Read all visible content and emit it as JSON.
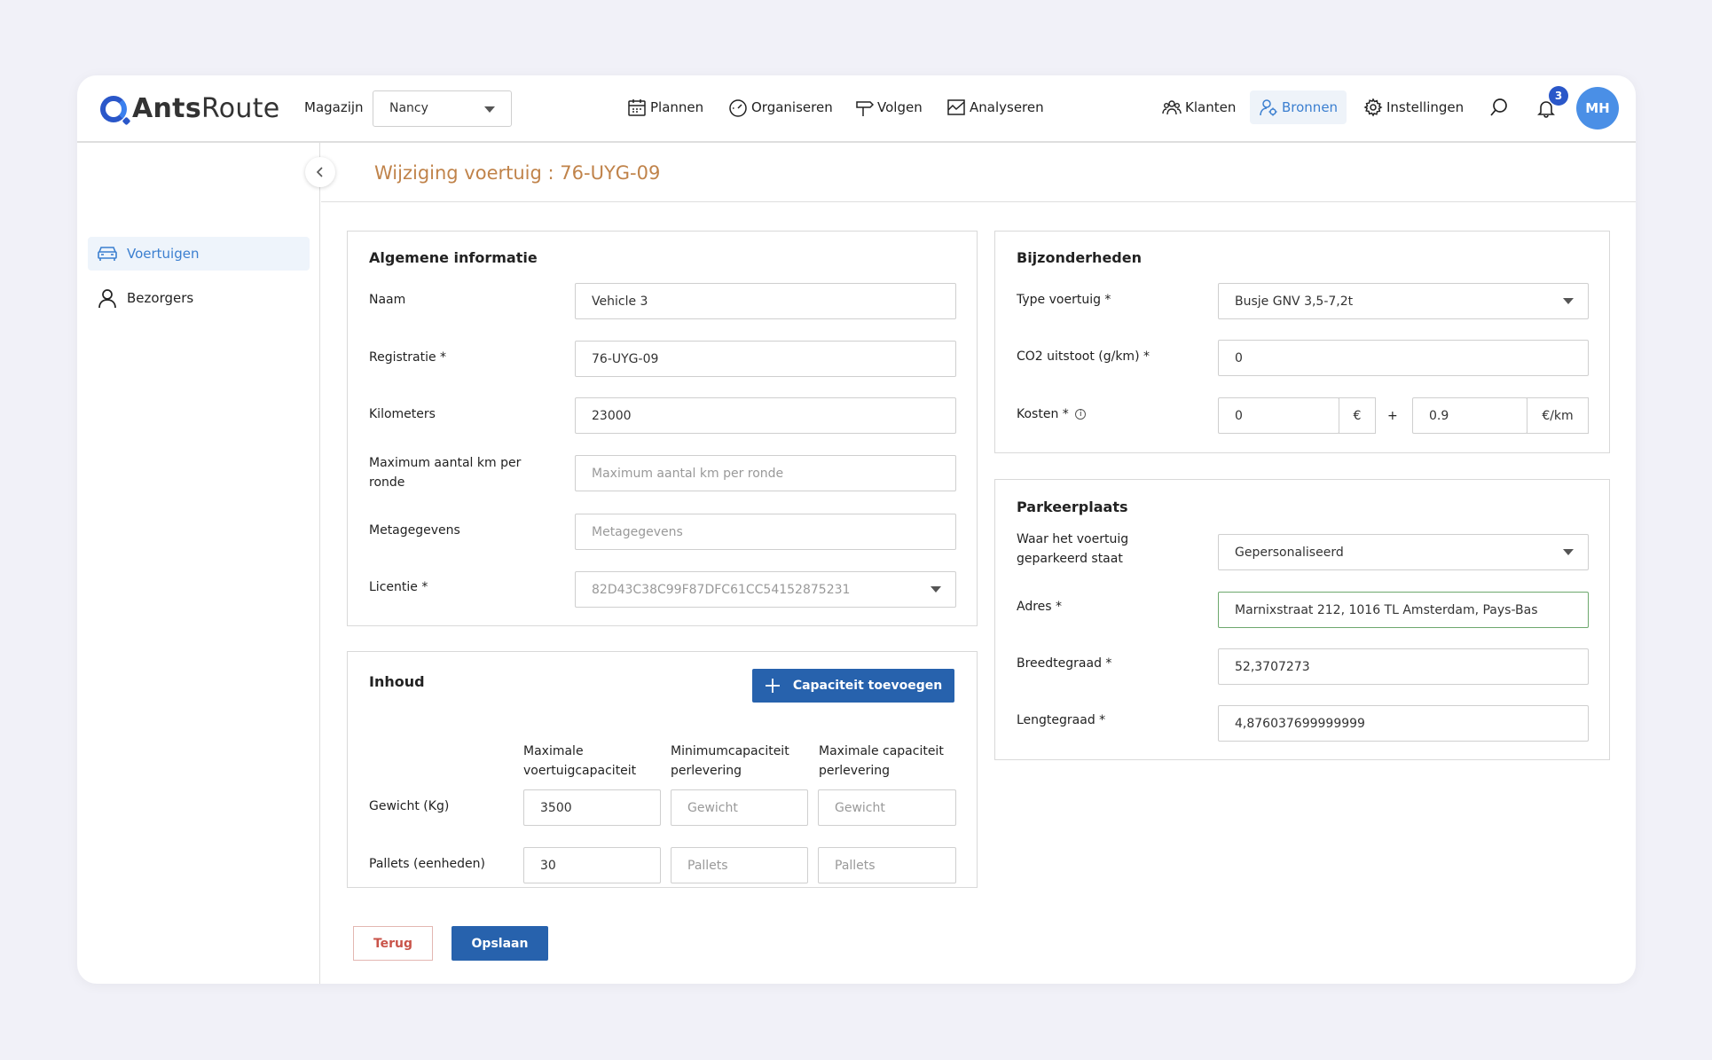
{
  "app": {
    "logo_bold": "Ants",
    "logo_light": "Route"
  },
  "topbar": {
    "warehouse_label": "Magazijn",
    "warehouse_value": "Nancy",
    "nav": {
      "plannen": "Plannen",
      "organiseren": "Organiseren",
      "volgen": "Volgen",
      "analyseren": "Analyseren",
      "klanten": "Klanten",
      "bronnen": "Bronnen",
      "instellingen": "Instellingen"
    },
    "notification_count": "3",
    "avatar_initials": "MH",
    "accent_color": "#2a57c9"
  },
  "sidebar": {
    "items": [
      {
        "label": "Voertuigen",
        "icon": "car-icon",
        "active": true
      },
      {
        "label": "Bezorgers",
        "icon": "user-icon",
        "active": false
      }
    ]
  },
  "page": {
    "title": "Wijziging voertuig : 76-UYG-09",
    "title_color": "#c0834a"
  },
  "general": {
    "title": "Algemene informatie",
    "name_label": "Naam",
    "name_value": "Vehicle 3",
    "registration_label": "Registratie *",
    "registration_value": "76-UYG-09",
    "kilometers_label": "Kilometers",
    "kilometers_value": "23000",
    "max_km_label": "Maximum aantal km per ronde",
    "max_km_placeholder": "Maximum aantal km per ronde",
    "meta_label": "Metagegevens",
    "meta_placeholder": "Metagegevens",
    "license_label": "Licentie *",
    "license_value": "82D43C38C99F87DFC61CC54152875231"
  },
  "content": {
    "title": "Inhoud",
    "add_capacity_button": "Capaciteit toevoegen",
    "columns": [
      "Maximale voertuigcapaciteit",
      "Minimumcapaciteit perlevering",
      "Maximale capaciteit perlevering"
    ],
    "rows": [
      {
        "label": "Gewicht (Kg)",
        "values": [
          "3500",
          "",
          ""
        ],
        "placeholders": [
          "",
          "Gewicht",
          "Gewicht"
        ]
      },
      {
        "label": "Pallets (eenheden)",
        "values": [
          "30",
          "",
          ""
        ],
        "placeholders": [
          "",
          "Pallets",
          "Pallets"
        ]
      }
    ]
  },
  "details": {
    "title": "Bijzonderheden",
    "type_label": "Type voertuig *",
    "type_value": "Busje GNV 3,5-7,2t",
    "co2_label": "CO2 uitstoot (g/km) *",
    "co2_value": "0",
    "cost_label": "Kosten *",
    "cost_fixed": "0",
    "cost_fixed_unit": "€",
    "cost_plus": "+",
    "cost_per_km": "0.9",
    "cost_per_km_unit": "€/km"
  },
  "parking": {
    "title": "Parkeerplaats",
    "where_label": "Waar het voertuig geparkeerd staat",
    "where_value": "Gepersonaliseerd",
    "address_label": "Adres *",
    "address_value": "Marnixstraat 212, 1016 TL Amsterdam, Pays-Bas",
    "lat_label": "Breedtegraad *",
    "lat_value": "52,3707273",
    "lng_label": "Lengtegraad *",
    "lng_value": "4,876037699999999"
  },
  "actions": {
    "back": "Terug",
    "save": "Opslaan"
  }
}
